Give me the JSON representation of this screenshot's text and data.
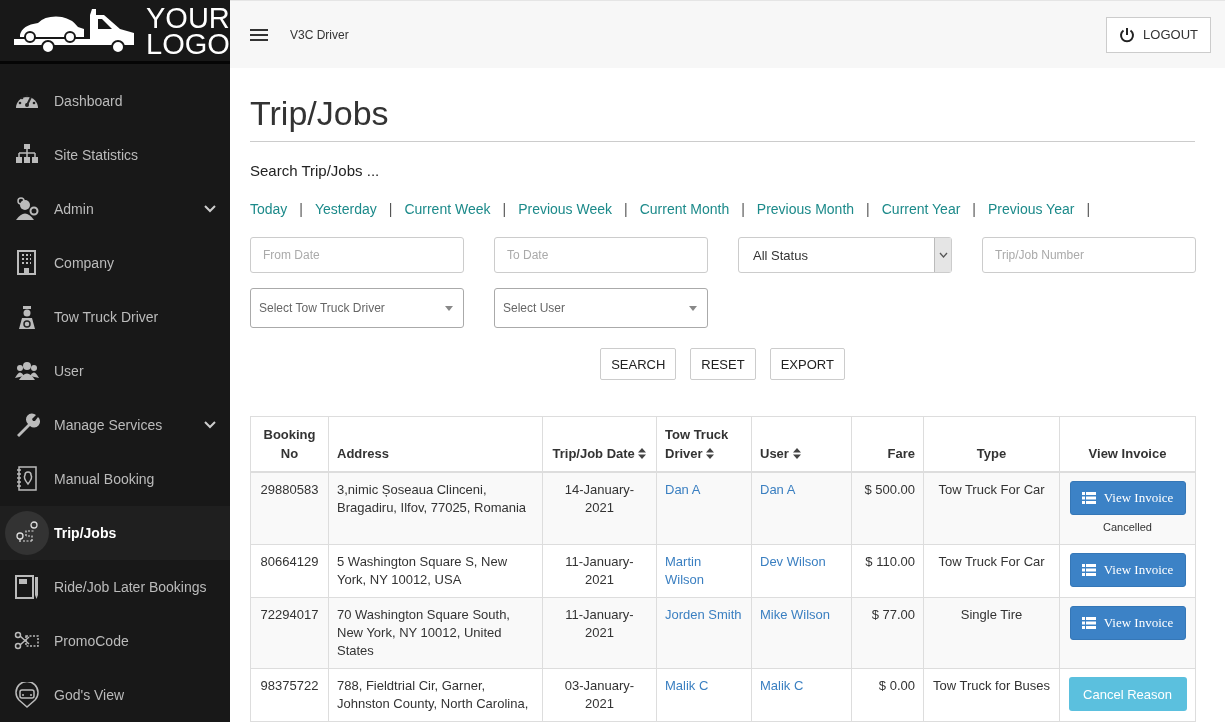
{
  "logo": {
    "line_1": "YOUR",
    "line_2": "LOGO"
  },
  "sidebar": {
    "items": [
      {
        "label": "Dashboard",
        "expandable": false,
        "selected": false
      },
      {
        "label": "Site Statistics",
        "expandable": false,
        "selected": false
      },
      {
        "label": "Admin",
        "expandable": true,
        "selected": false
      },
      {
        "label": "Company",
        "expandable": false,
        "selected": false
      },
      {
        "label": "Tow Truck Driver",
        "expandable": false,
        "selected": false
      },
      {
        "label": "User",
        "expandable": false,
        "selected": false
      },
      {
        "label": "Manage Services",
        "expandable": true,
        "selected": false
      },
      {
        "label": "Manual Booking",
        "expandable": false,
        "selected": false
      },
      {
        "label": "Trip/Jobs",
        "expandable": false,
        "selected": true
      },
      {
        "label": "Ride/Job Later Bookings",
        "expandable": false,
        "selected": false
      },
      {
        "label": "PromoCode",
        "expandable": false,
        "selected": false
      },
      {
        "label": "God's View",
        "expandable": false,
        "selected": false
      }
    ]
  },
  "topbar": {
    "app_name": "V3C Driver",
    "logout": "LOGOUT"
  },
  "page": {
    "title": "Trip/Jobs",
    "search_heading": "Search Trip/Jobs ..."
  },
  "periods": [
    {
      "label": "Today",
      "separator": "|"
    },
    {
      "label": "Yesterday",
      "separator": "|"
    },
    {
      "label": "Current Week",
      "separator": "|"
    },
    {
      "label": "Previous Week",
      "separator": "|"
    },
    {
      "label": "Current Month",
      "separator": "|"
    },
    {
      "label": "Previous Month",
      "separator": "|"
    },
    {
      "label": "Current Year",
      "separator": "|"
    },
    {
      "label": "Previous Year",
      "separator": "|"
    }
  ],
  "filters": {
    "from_date": {
      "placeholder": "From Date"
    },
    "to_date": {
      "placeholder": "To Date"
    },
    "status": {
      "value": "All Status"
    },
    "job_number": {
      "placeholder": "Trip/Job Number"
    },
    "driver": {
      "value": "Select Tow Truck Driver"
    },
    "user": {
      "value": "Select User"
    }
  },
  "buttons": [
    "SEARCH",
    "RESET",
    "EXPORT"
  ],
  "table": {
    "columns": [
      {
        "label": "Booking No",
        "sortable": false
      },
      {
        "label": "Address",
        "sortable": false
      },
      {
        "label": "Trip/Job Date",
        "sortable": true
      },
      {
        "label": "Tow Truck Driver",
        "sortable": true
      },
      {
        "label": "User",
        "sortable": true
      },
      {
        "label": "Fare",
        "sortable": false
      },
      {
        "label": "Type",
        "sortable": false
      },
      {
        "label": "View Invoice",
        "sortable": false
      }
    ],
    "rows": [
      {
        "booking_no": "29880583",
        "address": "3,nimic Șoseaua Clinceni, Bragadiru, Ilfov, 77025, Romania",
        "date": "14-January-2021",
        "driver": "Dan A",
        "user": "Dan A",
        "fare": "$ 500.00",
        "type": "Tow Truck For Car",
        "action": {
          "kind": "invoice",
          "label": "View Invoice"
        },
        "status": "Cancelled"
      },
      {
        "booking_no": "80664129",
        "address": "5 Washington Square S, New York, NY 10012, USA",
        "date": "11-January-2021",
        "driver": "Martin Wilson",
        "user": "Dev Wilson",
        "fare": "$ 110.00",
        "type": "Tow Truck For Car",
        "action": {
          "kind": "invoice",
          "label": "View Invoice"
        }
      },
      {
        "booking_no": "72294017",
        "address": "70 Washington Square South, New York, NY 10012, United States",
        "date": "11-January-2021",
        "driver": "Jorden Smith",
        "user": "Mike Wilson",
        "fare": "$ 77.00",
        "type": "Single Tire",
        "action": {
          "kind": "invoice",
          "label": "View Invoice"
        }
      },
      {
        "booking_no": "98375722",
        "address": "788, Fieldtrial Cir, Garner, Johnston County, North Carolina,",
        "date": "03-January-2021",
        "driver": "Malik C",
        "user": "Malik C",
        "fare": "$ 0.00",
        "type": "Tow Truck for Buses",
        "action": {
          "kind": "cancel",
          "label": "Cancel Reason"
        }
      }
    ]
  }
}
